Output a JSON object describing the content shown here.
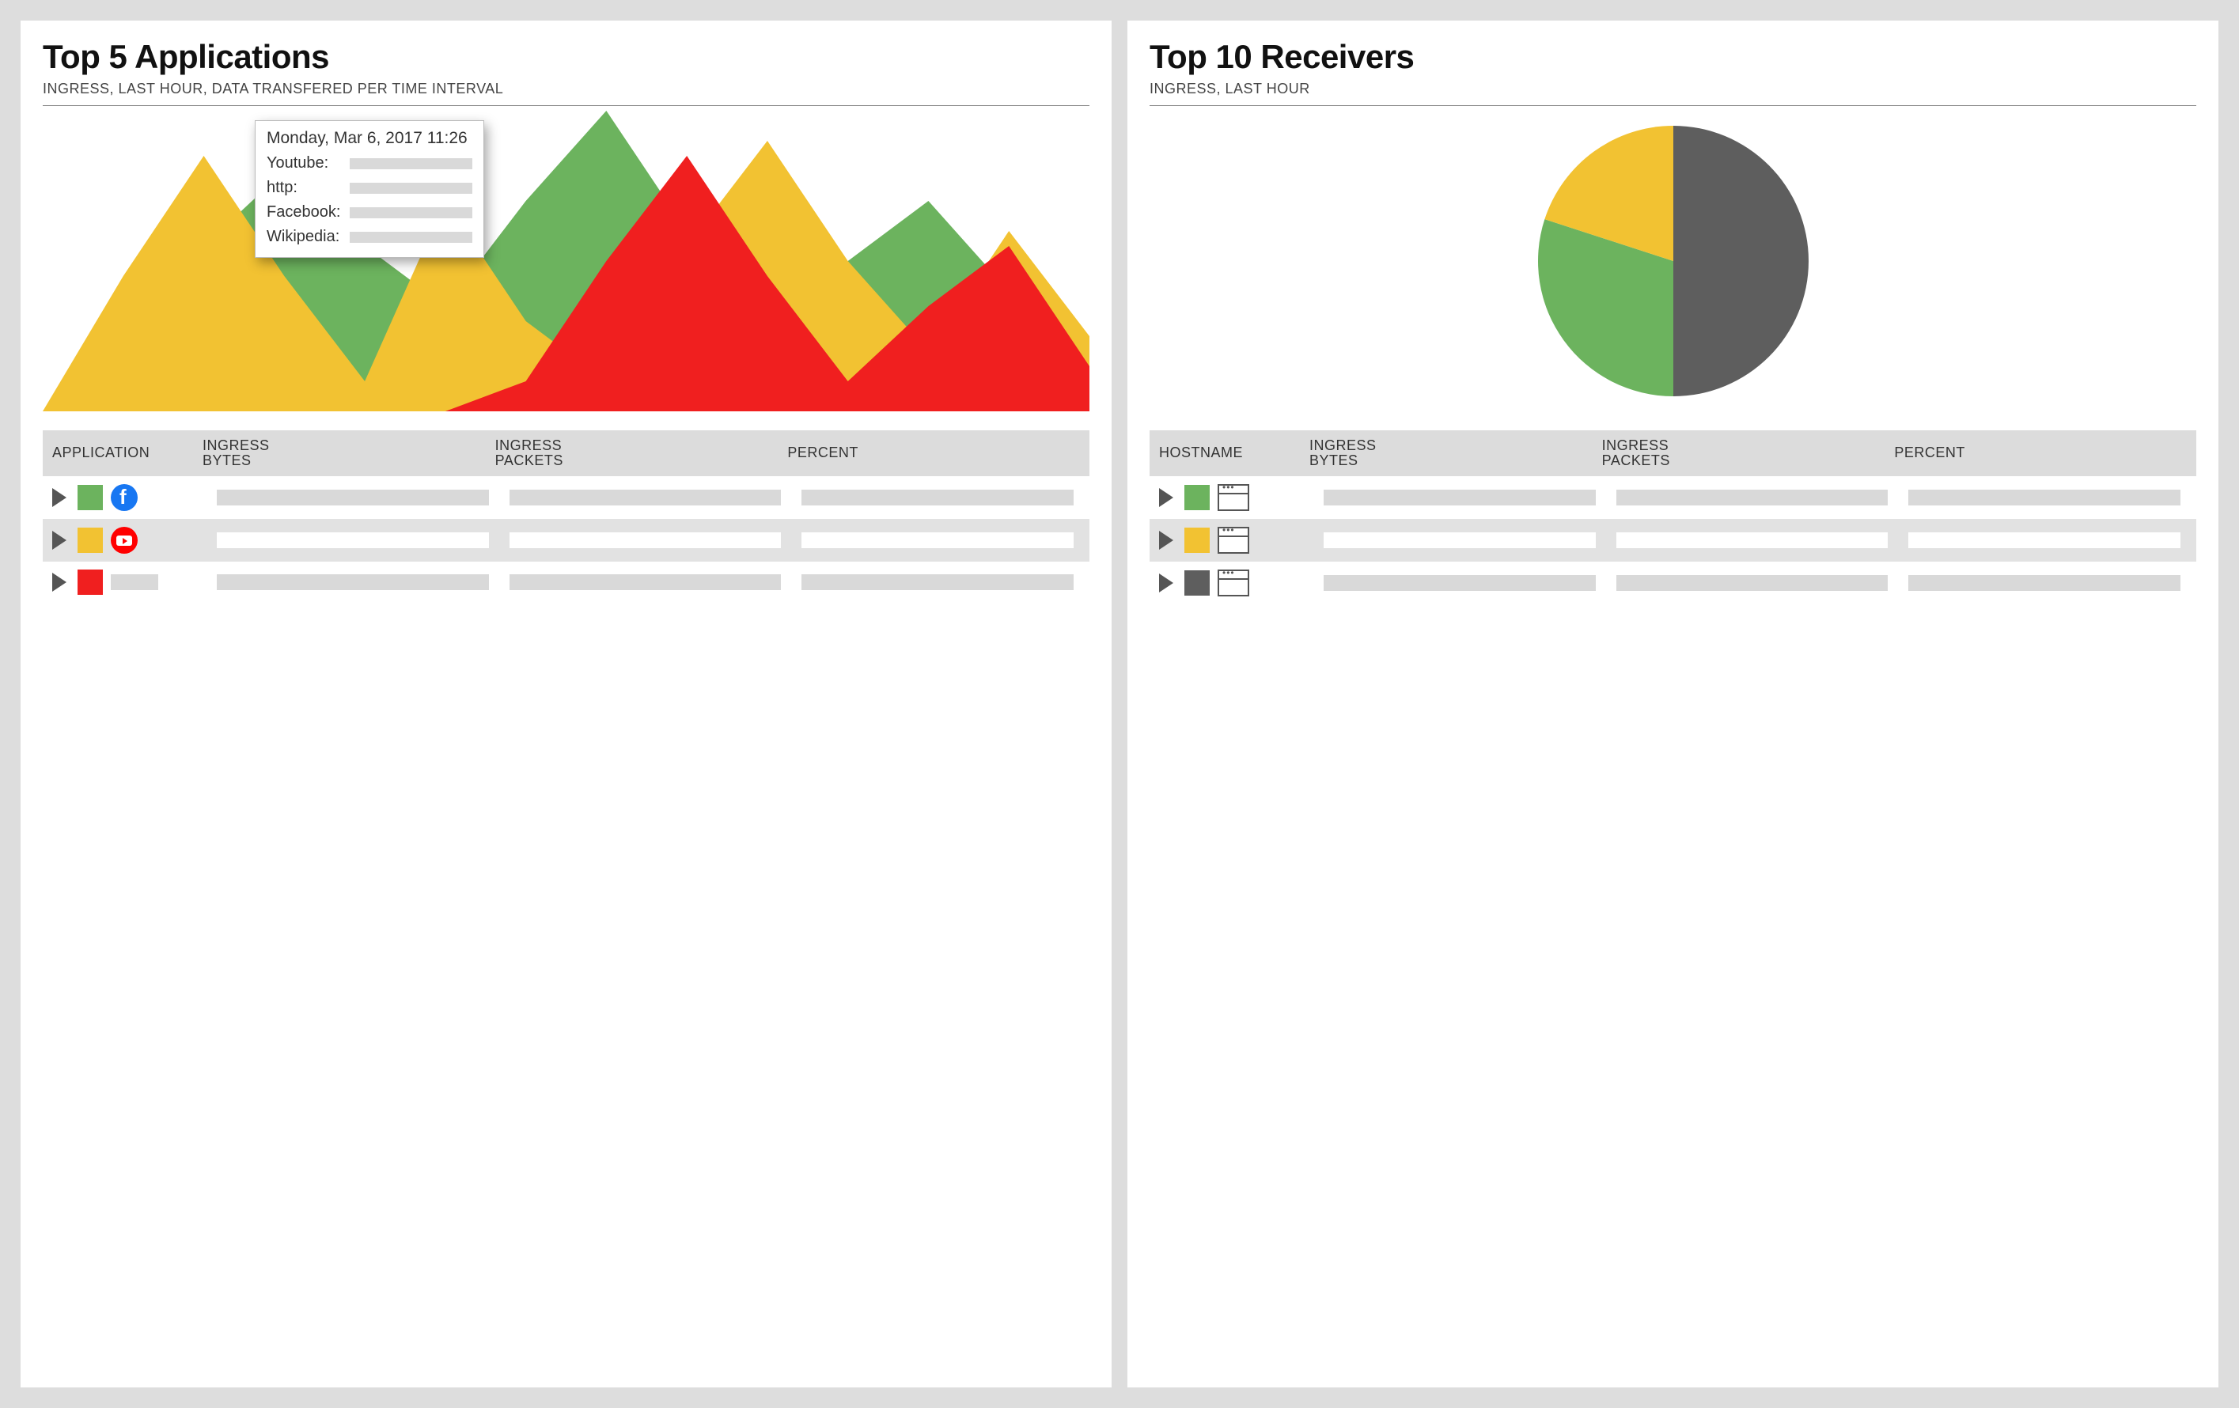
{
  "colors": {
    "green": "#6CB35E",
    "yellow": "#F2C232",
    "red": "#F01F1F",
    "gray": "#5E5E5E"
  },
  "left": {
    "title": "Top 5 Applications",
    "subtitle": "INGRESS, LAST HOUR, DATA TRANSFERED PER TIME INTERVAL",
    "tooltip": {
      "timestamp": "Monday, Mar 6, 2017 11:26",
      "rows": [
        "Youtube:",
        "http:",
        "Facebook:",
        "Wikipedia:"
      ]
    },
    "table": {
      "headers": [
        "APPLICATION",
        "INGRESS BYTES",
        "INGRESS PACKETS",
        "PERCENT"
      ],
      "rows": [
        {
          "color": "green",
          "icon": "facebook"
        },
        {
          "color": "yellow",
          "icon": "youtube"
        },
        {
          "color": "red",
          "icon": null
        }
      ]
    }
  },
  "right": {
    "title": "Top 10 Receivers",
    "subtitle": "INGRESS, LAST HOUR",
    "table": {
      "headers": [
        "HOSTNAME",
        "INGRESS BYTES",
        "INGRESS PACKETS",
        "PERCENT"
      ],
      "rows": [
        {
          "color": "green",
          "icon": "browser"
        },
        {
          "color": "yellow",
          "icon": "browser"
        },
        {
          "color": "gray",
          "icon": "browser"
        }
      ]
    }
  },
  "chart_data": [
    {
      "type": "area",
      "title": "Top 5 Applications — Ingress, last hour, data transfered per time interval",
      "x": [
        0,
        1,
        2,
        3,
        4,
        5,
        6,
        7,
        8,
        9,
        10,
        11,
        12,
        13
      ],
      "series": [
        {
          "name": "green",
          "color": "#6CB35E",
          "values": [
            0,
            30,
            55,
            80,
            55,
            35,
            70,
            100,
            60,
            30,
            50,
            70,
            40,
            15
          ]
        },
        {
          "name": "yellow",
          "color": "#F2C232",
          "values": [
            0,
            45,
            85,
            45,
            10,
            70,
            30,
            10,
            55,
            90,
            50,
            20,
            60,
            25
          ]
        },
        {
          "name": "red",
          "color": "#F01F1F",
          "values": [
            0,
            0,
            0,
            0,
            0,
            0,
            10,
            50,
            85,
            45,
            10,
            35,
            55,
            15
          ]
        }
      ],
      "xlabel": "",
      "ylabel": "",
      "ylim": [
        0,
        100
      ]
    },
    {
      "type": "pie",
      "title": "Top 10 Receivers — Ingress, last hour",
      "categories": [
        "gray",
        "green",
        "yellow"
      ],
      "values": [
        50,
        30,
        20
      ],
      "colors": [
        "#5E5E5E",
        "#6CB35E",
        "#F2C232"
      ]
    }
  ]
}
